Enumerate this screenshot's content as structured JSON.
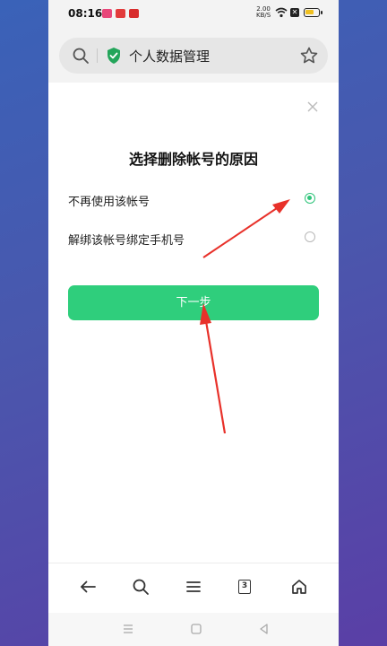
{
  "status_bar": {
    "time": "08:16",
    "network_speed_value": "2.00",
    "network_speed_unit": "KB/S",
    "icons": [
      "notification-app-icon",
      "notification-app-icon",
      "notification-app-icon",
      "wifi-icon",
      "sim-x-icon",
      "battery-icon"
    ]
  },
  "browser": {
    "page_title": "个人数据管理",
    "icons": [
      "search-icon",
      "shield-check-icon",
      "star-icon"
    ]
  },
  "dialog": {
    "title": "选择删除帐号的原因",
    "options": [
      {
        "label": "不再使用该帐号",
        "selected": true
      },
      {
        "label": "解绑该帐号绑定手机号",
        "selected": false
      }
    ],
    "next_label": "下一步"
  },
  "bottom_nav": {
    "tab_count": "3",
    "icons": [
      "back-arrow-icon",
      "search-icon",
      "menu-icon",
      "tabs-icon",
      "home-icon"
    ]
  },
  "colors": {
    "accent": "#2fce7c",
    "radio_selected": "#2fc47a",
    "annotation_arrow": "#e8312a"
  }
}
